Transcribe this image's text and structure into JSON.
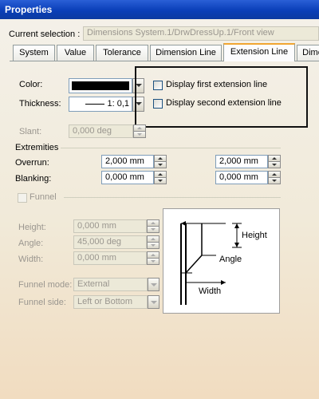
{
  "window": {
    "title": "Properties"
  },
  "current_selection": {
    "label": "Current selection :",
    "value": "Dimensions System.1/DrwDressUp.1/Front view"
  },
  "tabs": [
    {
      "label": "System"
    },
    {
      "label": "Value"
    },
    {
      "label": "Tolerance"
    },
    {
      "label": "Dimension Line"
    },
    {
      "label": "Extension Line"
    },
    {
      "label": "Dime"
    }
  ],
  "color": {
    "label": "Color:",
    "value_hex": "#000000"
  },
  "thickness": {
    "label": "Thickness:",
    "value": "1: 0,1"
  },
  "checkboxes": {
    "first": "Display first extension line",
    "second": "Display second extension line"
  },
  "slant": {
    "label": "Slant:",
    "value": "0,000 deg"
  },
  "extremities": {
    "heading": "Extremities",
    "overrun_label": "Overrun:",
    "overrun_1": "2,000 mm",
    "overrun_2": "2,000 mm",
    "blanking_label": "Blanking:",
    "blanking_1": "0,000 mm",
    "blanking_2": "0,000 mm"
  },
  "funnel": {
    "label": "Funnel",
    "height_label": "Height:",
    "height_value": "0,000 mm",
    "angle_label": "Angle:",
    "angle_value": "45,000 deg",
    "width_label": "Width:",
    "width_value": "0,000 mm",
    "mode_label": "Funnel mode:",
    "mode_value": "External",
    "side_label": "Funnel side:",
    "side_value": "Left or Bottom"
  },
  "diagram": {
    "height": "Height",
    "angle": "Angle",
    "width": "Width"
  }
}
